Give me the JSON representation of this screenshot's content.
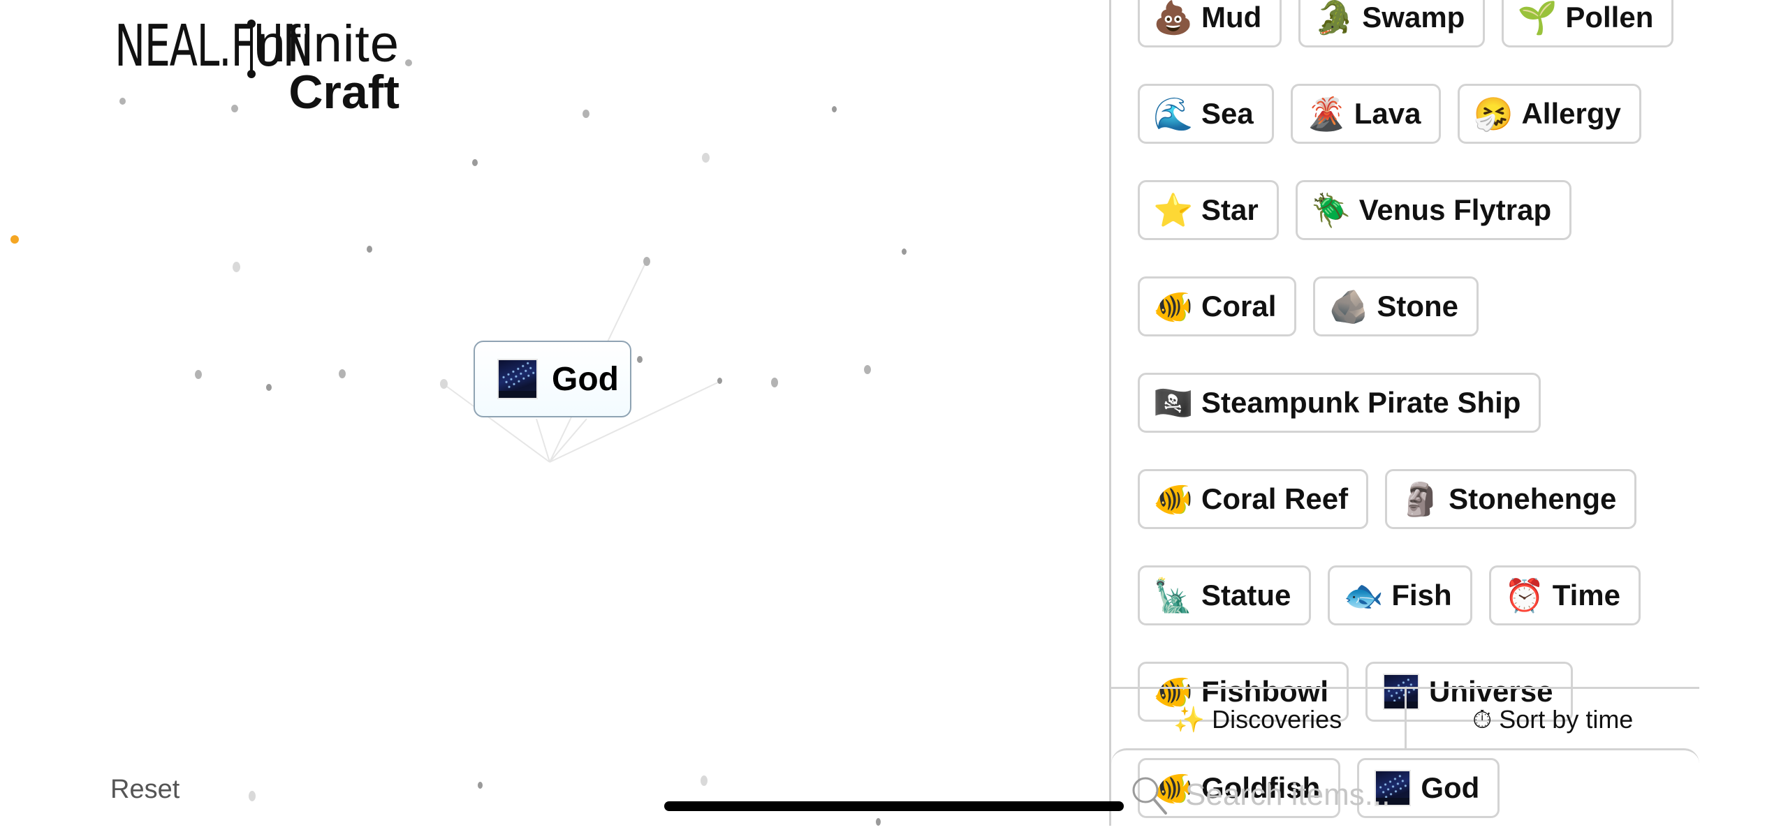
{
  "header": {
    "site_logo": "NEAL.FUN",
    "title_line1": "nfinite",
    "title_line2": "Craft"
  },
  "canvas": {
    "placed_item": {
      "emoji": "universe-image",
      "label": "God"
    },
    "reset_label": "Reset"
  },
  "sidebar": {
    "items": [
      {
        "emoji": "💩",
        "icon": "pile-of-poo-icon",
        "label": "Mud"
      },
      {
        "emoji": "🐊",
        "icon": "crocodile-icon",
        "label": "Swamp"
      },
      {
        "emoji": "🌱",
        "icon": "seedling-icon",
        "label": "Pollen"
      },
      {
        "emoji": "🌊",
        "icon": "wave-icon",
        "label": "Sea"
      },
      {
        "emoji": "🌋",
        "icon": "volcano-icon",
        "label": "Lava"
      },
      {
        "emoji": "🤧",
        "icon": "sneezing-face-icon",
        "label": "Allergy"
      },
      {
        "emoji": "⭐",
        "icon": "star-icon",
        "label": "Star"
      },
      {
        "emoji": "🪲",
        "icon": "beetle-icon",
        "label": "Venus Flytrap"
      },
      {
        "emoji": "🐠",
        "icon": "tropical-fish-icon",
        "label": "Coral"
      },
      {
        "emoji": "🪨",
        "icon": "rock-icon",
        "label": "Stone"
      },
      {
        "emoji": "🏴‍☠️",
        "icon": "pirate-flag-icon",
        "label": "Steampunk Pirate Ship"
      },
      {
        "emoji": "🐠",
        "icon": "tropical-fish-icon",
        "label": "Coral Reef"
      },
      {
        "emoji": "🗿",
        "icon": "moai-icon",
        "label": "Stonehenge"
      },
      {
        "emoji": "🗽",
        "icon": "statue-of-liberty-icon",
        "label": "Statue"
      },
      {
        "emoji": "🐟",
        "icon": "fish-icon",
        "label": "Fish"
      },
      {
        "emoji": "⏰",
        "icon": "alarm-clock-icon",
        "label": "Time"
      },
      {
        "emoji": "🐠",
        "icon": "tropical-fish-icon",
        "label": "Fishbowl"
      },
      {
        "emoji": "🌌",
        "icon": "milky-way-icon",
        "label": "Universe"
      },
      {
        "emoji": "🐠",
        "icon": "tropical-fish-icon",
        "label": "Goldfish"
      },
      {
        "emoji": "🌌",
        "icon": "milky-way-icon",
        "label": "God"
      }
    ],
    "tabs": [
      {
        "icon": "✨",
        "label": "Discoveries"
      },
      {
        "icon": "⏱",
        "label": "Sort by time"
      }
    ],
    "search": {
      "placeholder": "Search items...",
      "value": ""
    }
  },
  "colors": {
    "chip_border": "#d3d3d3",
    "placed_border": "#8fa3b3",
    "accent_dot": "#f5a623"
  }
}
